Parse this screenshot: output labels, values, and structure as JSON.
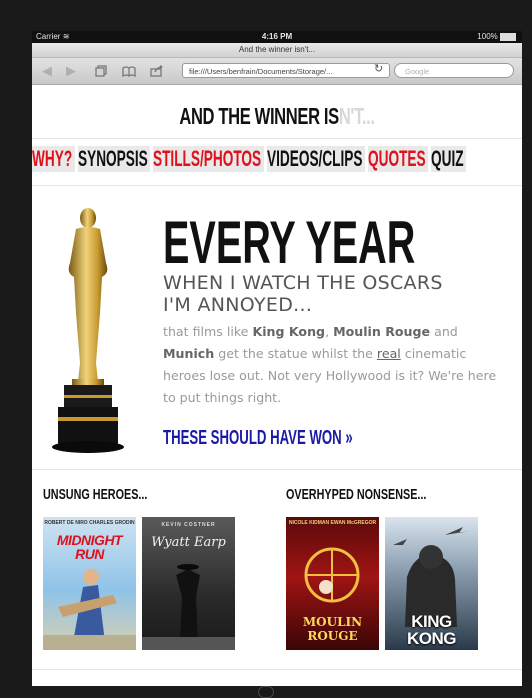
{
  "status_bar": {
    "carrier": "Carrier",
    "time": "4:16 PM",
    "battery": "100%"
  },
  "browser": {
    "page_title": "And the winner isn't...",
    "url": "file:///Users/benfrain/Documents/Storage/...",
    "search_placeholder": "Google"
  },
  "site": {
    "title_main": "AND THE WINNER IS",
    "title_faded": "N'T...",
    "nav": [
      {
        "label": "WHY?",
        "color": "#e0101c"
      },
      {
        "label": "SYNOPSIS",
        "color": "#111111"
      },
      {
        "label": "STILLS/PHOTOS",
        "color": "#e0101c"
      },
      {
        "label": "VIDEOS/CLIPS",
        "color": "#111111"
      },
      {
        "label": "QUOTES",
        "color": "#e0101c"
      },
      {
        "label": "QUIZ",
        "color": "#111111"
      }
    ],
    "hero": {
      "heading": "EVERY YEAR",
      "subheading_line1": "WHEN I WATCH THE OSCARS",
      "subheading_line2": "I'M ANNOYED...",
      "p1": "that films like ",
      "film1": "King Kong",
      "p2": ", ",
      "film2": "Moulin Rouge",
      "p3": " and ",
      "film3": "Munich",
      "p4": " get the statue whilst the ",
      "real": "real",
      "p5": " cinematic heroes lose out. Not very Hollywood is it? We're here to put things right.",
      "cta": "THESE SHOULD HAVE WON »"
    },
    "unsung": {
      "heading": "UNSUNG HEROES...",
      "posters": [
        {
          "top": "ROBERT DE NIRO   CHARLES GRODIN",
          "title": "MIDNIGHT RUN"
        },
        {
          "top": "KEVIN COSTNER",
          "title": "Wyatt Earp"
        }
      ]
    },
    "overhyped": {
      "heading": "OVERHYPED NONSENSE...",
      "posters": [
        {
          "top": "NICOLE KIDMAN   EWAN McGREGOR",
          "title": "MOULIN ROUGE"
        },
        {
          "top": "",
          "title": "KING KONG"
        }
      ]
    }
  }
}
